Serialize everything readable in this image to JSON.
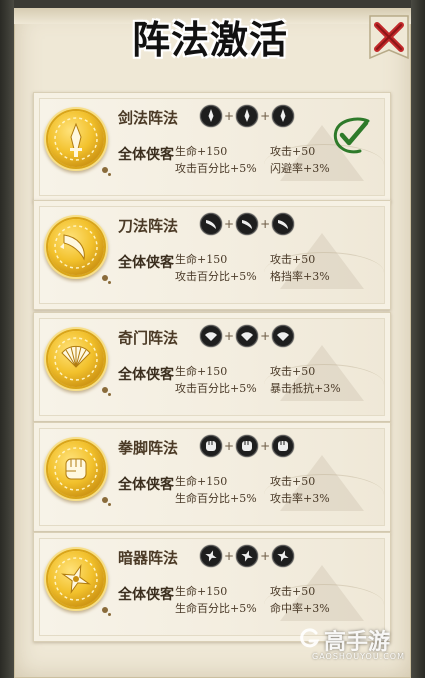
{
  "title": "阵法激活",
  "close_icon": "close-x-icon",
  "colors": {
    "gold": "#f2c12c",
    "panel": "#efe8d6",
    "text": "#4b3a26",
    "check": "#2e7a2a",
    "close": "#c2282a"
  },
  "formations": [
    {
      "name": "剑法阵法",
      "icon": "sword-icon",
      "target": "全体侠客",
      "stats": [
        "生命+150",
        "攻击+50",
        "攻击百分比+5%",
        "闪避率+3%"
      ],
      "active": true
    },
    {
      "name": "刀法阵法",
      "icon": "saber-icon",
      "target": "全体侠客",
      "stats": [
        "生命+150",
        "攻击+50",
        "攻击百分比+5%",
        "格挡率+3%"
      ],
      "active": false
    },
    {
      "name": "奇门阵法",
      "icon": "fan-icon",
      "target": "全体侠客",
      "stats": [
        "生命+150",
        "攻击+50",
        "攻击百分比+5%",
        "暴击抵抗+3%"
      ],
      "active": false
    },
    {
      "name": "拳脚阵法",
      "icon": "fist-icon",
      "target": "全体侠客",
      "stats": [
        "生命+150",
        "攻击+50",
        "生命百分比+5%",
        "攻击率+3%"
      ],
      "active": false
    },
    {
      "name": "暗器阵法",
      "icon": "shuriken-icon",
      "target": "全体侠客",
      "stats": [
        "生命+150",
        "攻击+50",
        "生命百分比+5%",
        "命中率+3%"
      ],
      "active": false
    }
  ],
  "watermark": {
    "brand": "高手游",
    "url": "GAOSHOUYOU.COM"
  }
}
